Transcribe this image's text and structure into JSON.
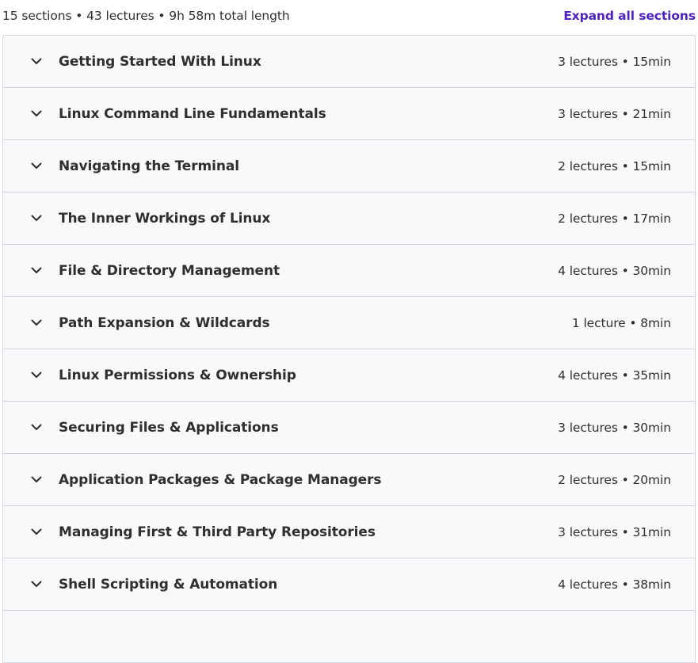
{
  "summary": {
    "text": "15 sections • 43 lectures • 9h 58m total length",
    "expand_label": "Expand all sections",
    "accent_color": "#5022c3"
  },
  "sections": [
    {
      "title": "Getting Started With Linux",
      "meta": "3 lectures • 15min",
      "icon": "chevron-down-icon"
    },
    {
      "title": "Linux Command Line Fundamentals",
      "meta": "3 lectures • 21min",
      "icon": "chevron-down-icon"
    },
    {
      "title": "Navigating the Terminal",
      "meta": "2 lectures • 15min",
      "icon": "chevron-down-icon"
    },
    {
      "title": "The Inner Workings of Linux",
      "meta": "2 lectures • 17min",
      "icon": "chevron-down-icon"
    },
    {
      "title": "File & Directory Management",
      "meta": "4 lectures • 30min",
      "icon": "chevron-down-icon"
    },
    {
      "title": "Path Expansion & Wildcards",
      "meta": "1 lecture • 8min",
      "icon": "chevron-down-icon"
    },
    {
      "title": "Linux Permissions & Ownership",
      "meta": "4 lectures • 35min",
      "icon": "chevron-down-icon"
    },
    {
      "title": "Securing Files & Applications",
      "meta": "3 lectures • 30min",
      "icon": "chevron-down-icon"
    },
    {
      "title": "Application Packages & Package Managers",
      "meta": "2 lectures • 20min",
      "icon": "chevron-down-icon"
    },
    {
      "title": "Managing First & Third Party Repositories",
      "meta": "3 lectures • 31min",
      "icon": "chevron-down-icon"
    },
    {
      "title": "Shell Scripting & Automation",
      "meta": "4 lectures • 38min",
      "icon": "chevron-down-icon"
    }
  ]
}
